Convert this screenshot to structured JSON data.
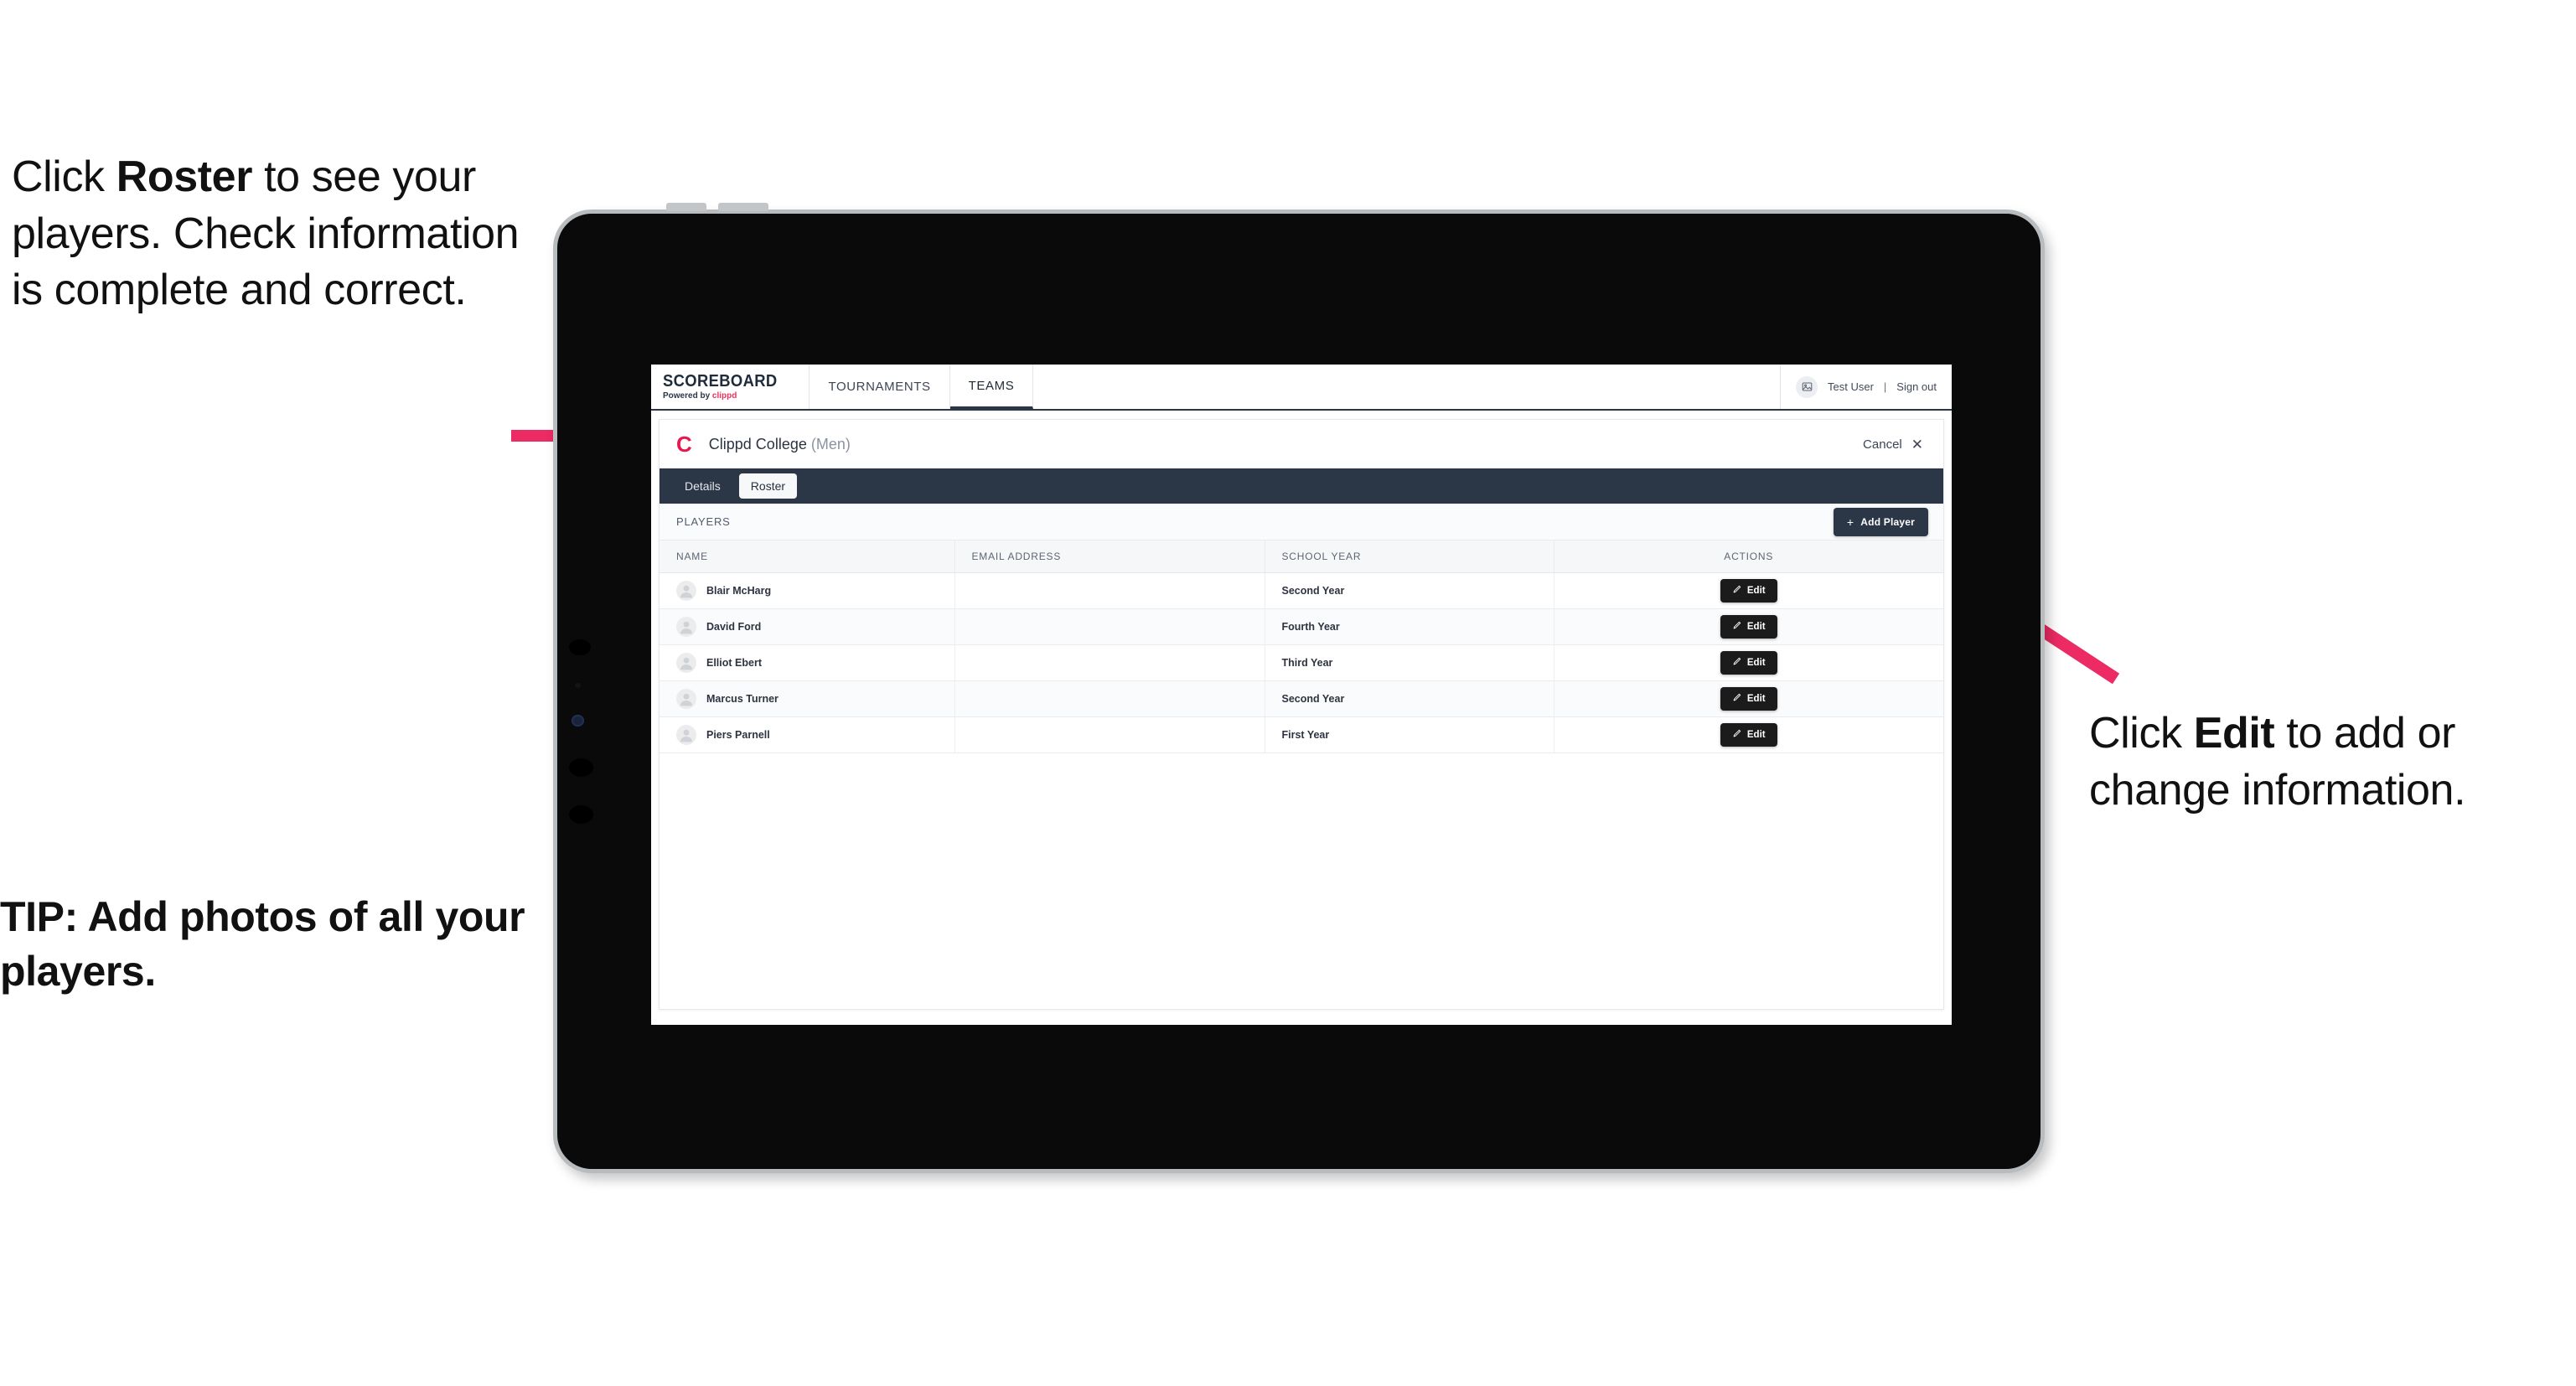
{
  "annotations": {
    "left_callout": {
      "prefix": "Click ",
      "bold": "Roster",
      "suffix": " to see your players. Check information is complete and correct."
    },
    "tip": "TIP: Add photos of all your players.",
    "right_callout": {
      "prefix": "Click ",
      "bold": "Edit",
      "suffix": " to add or change information."
    },
    "arrow_color": "#ec2a63"
  },
  "app": {
    "brand": {
      "title": "SCOREBOARD",
      "sub_prefix": "Powered by ",
      "sub_accent": "clippd"
    },
    "nav_tabs": [
      {
        "label": "TOURNAMENTS",
        "active": false
      },
      {
        "label": "TEAMS",
        "active": true
      }
    ],
    "user": {
      "avatar_icon": "user-avatar-icon",
      "name": "Test User",
      "separator": "|",
      "sign_out": "Sign out"
    },
    "card": {
      "club_logo_letter": "C",
      "club_name": "Clippd College",
      "club_gender": "(Men)",
      "cancel_label": "Cancel",
      "close_icon": "✕",
      "tabs": [
        {
          "label": "Details",
          "selected": false
        },
        {
          "label": "Roster",
          "selected": true
        }
      ],
      "section_label": "PLAYERS",
      "add_player": {
        "plus": "+",
        "label": "Add Player"
      },
      "table": {
        "columns": [
          "NAME",
          "EMAIL ADDRESS",
          "SCHOOL YEAR",
          "ACTIONS"
        ],
        "action_label": "Edit",
        "rows": [
          {
            "name": "Blair McHarg",
            "email": "",
            "year": "Second Year"
          },
          {
            "name": "David Ford",
            "email": "",
            "year": "Fourth Year"
          },
          {
            "name": "Elliot Ebert",
            "email": "",
            "year": "Third Year"
          },
          {
            "name": "Marcus Turner",
            "email": "",
            "year": "Second Year"
          },
          {
            "name": "Piers Parnell",
            "email": "",
            "year": "First Year"
          }
        ]
      }
    }
  },
  "colors": {
    "navy": "#2b3647",
    "accent_pink": "#e8174e",
    "dark_button": "#1b1b1b",
    "arrow": "#ec2a63"
  }
}
